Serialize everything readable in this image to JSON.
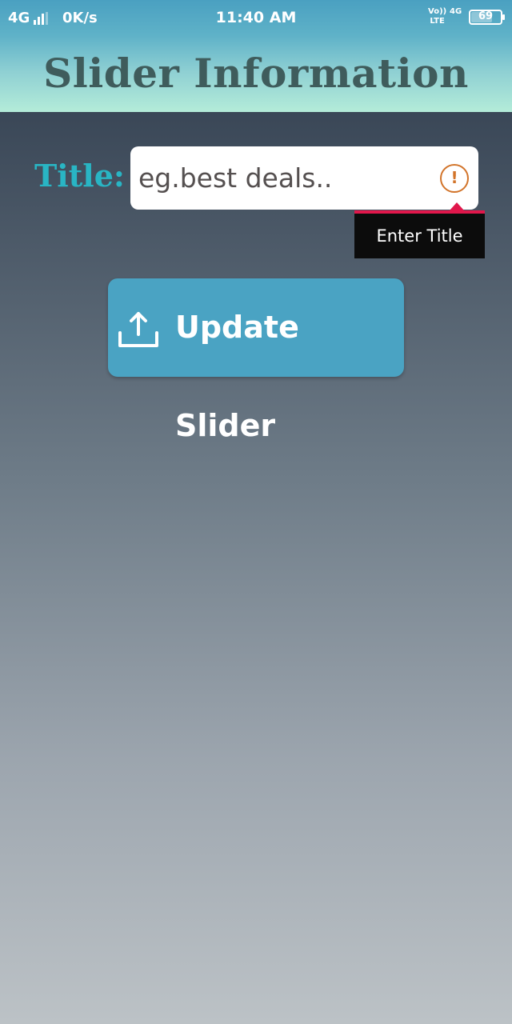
{
  "status_bar": {
    "network": "4G",
    "speed": "0K/s",
    "time": "11:40 AM",
    "volte_line1": "Vo))",
    "volte_line2": "LTE",
    "network2": "4G",
    "battery_level": "69",
    "icons": [
      "signal-icon",
      "battery-icon"
    ]
  },
  "header": {
    "title": "Slider Information"
  },
  "form": {
    "title_label": "Title:",
    "title_placeholder": "eg.best deals..",
    "title_value": "",
    "error_icon": "error-icon",
    "error_tooltip": "Enter Title"
  },
  "actions": {
    "update_label": "Update Slider",
    "update_icon": "upload-icon"
  },
  "colors": {
    "header_top": "#4aa0c1",
    "header_bottom": "#b4ecd9",
    "title_text": "#3f5c5c",
    "label_accent": "#29b5c4",
    "error": "#d2742a",
    "tooltip_bg": "#0c0c0c",
    "tooltip_border": "#e0174b",
    "button_bg": "#4aa3c3"
  }
}
